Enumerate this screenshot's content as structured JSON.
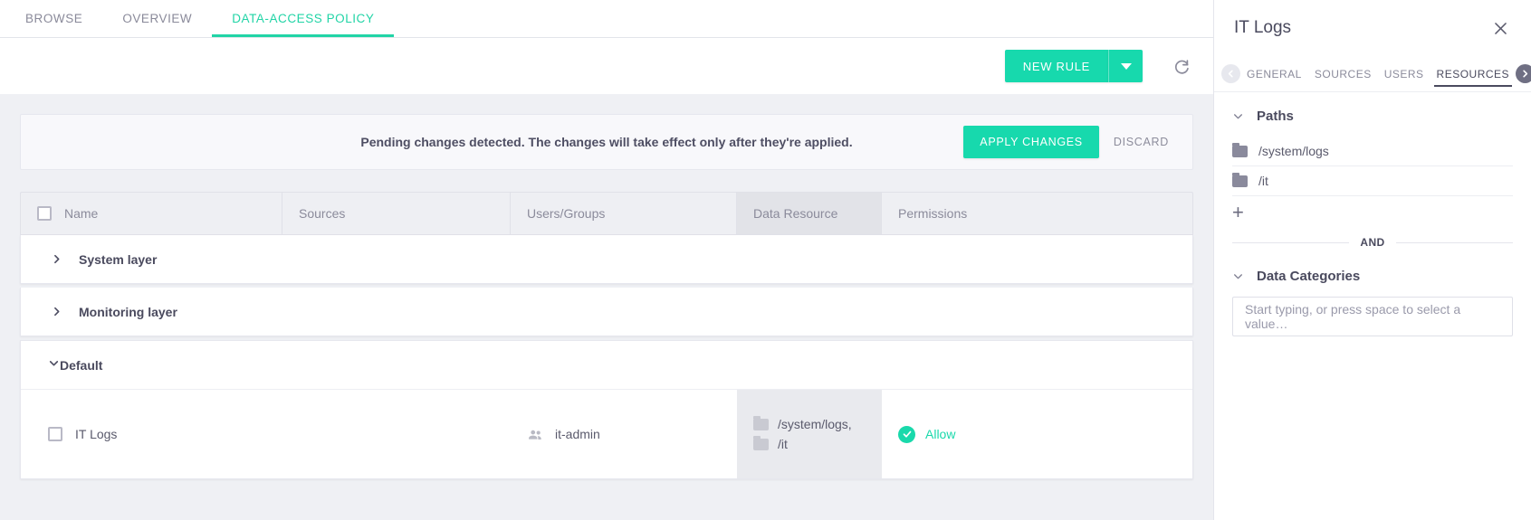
{
  "top_tabs": [
    {
      "label": "BROWSE",
      "active": false
    },
    {
      "label": "OVERVIEW",
      "active": false
    },
    {
      "label": "DATA-ACCESS POLICY",
      "active": true
    }
  ],
  "toolbar": {
    "new_rule_label": "NEW RULE",
    "dropdown_icon": "chevron-down-icon",
    "refresh_icon": "refresh-icon"
  },
  "banner": {
    "message": "Pending changes detected. The changes will take effect only after they're applied.",
    "apply_label": "APPLY CHANGES",
    "discard_label": "DISCARD"
  },
  "table": {
    "columns": [
      {
        "label": "Name",
        "highlight": false
      },
      {
        "label": "Sources",
        "highlight": false
      },
      {
        "label": "Users/Groups",
        "highlight": false
      },
      {
        "label": "Data Resource",
        "highlight": true
      },
      {
        "label": "Permissions",
        "highlight": false
      }
    ],
    "layers": [
      {
        "label": "System layer",
        "expanded": false
      },
      {
        "label": "Monitoring layer",
        "expanded": false
      },
      {
        "label": "Default",
        "expanded": true
      }
    ],
    "rows": [
      {
        "name": "IT Logs",
        "sources": "",
        "users_groups": "it-admin",
        "users_icon": "group-icon",
        "data_resources": [
          "/system/logs,",
          "/it"
        ],
        "permission": "Allow",
        "permission_icon": "check-circle-icon"
      }
    ]
  },
  "side_panel": {
    "title": "IT Logs",
    "close_icon": "close-icon",
    "nav_prev_icon": "chevron-left-circle-icon",
    "nav_next_icon": "chevron-right-circle-icon",
    "tabs": [
      {
        "label": "GENERAL",
        "active": false
      },
      {
        "label": "SOURCES",
        "active": false
      },
      {
        "label": "USERS",
        "active": false
      },
      {
        "label": "RESOURCES",
        "active": true
      }
    ],
    "paths_section": {
      "title": "Paths",
      "expanded": true,
      "items": [
        "/system/logs",
        "/it"
      ],
      "add_label": "+"
    },
    "operator": "AND",
    "categories_section": {
      "title": "Data Categories",
      "expanded": true,
      "input_placeholder": "Start typing, or press space to select a value…",
      "input_value": ""
    }
  },
  "colors": {
    "accent": "#17d9ad",
    "text": "#4a4a5e",
    "muted": "#8b8b9b",
    "panel_bg": "#eff0f4"
  }
}
